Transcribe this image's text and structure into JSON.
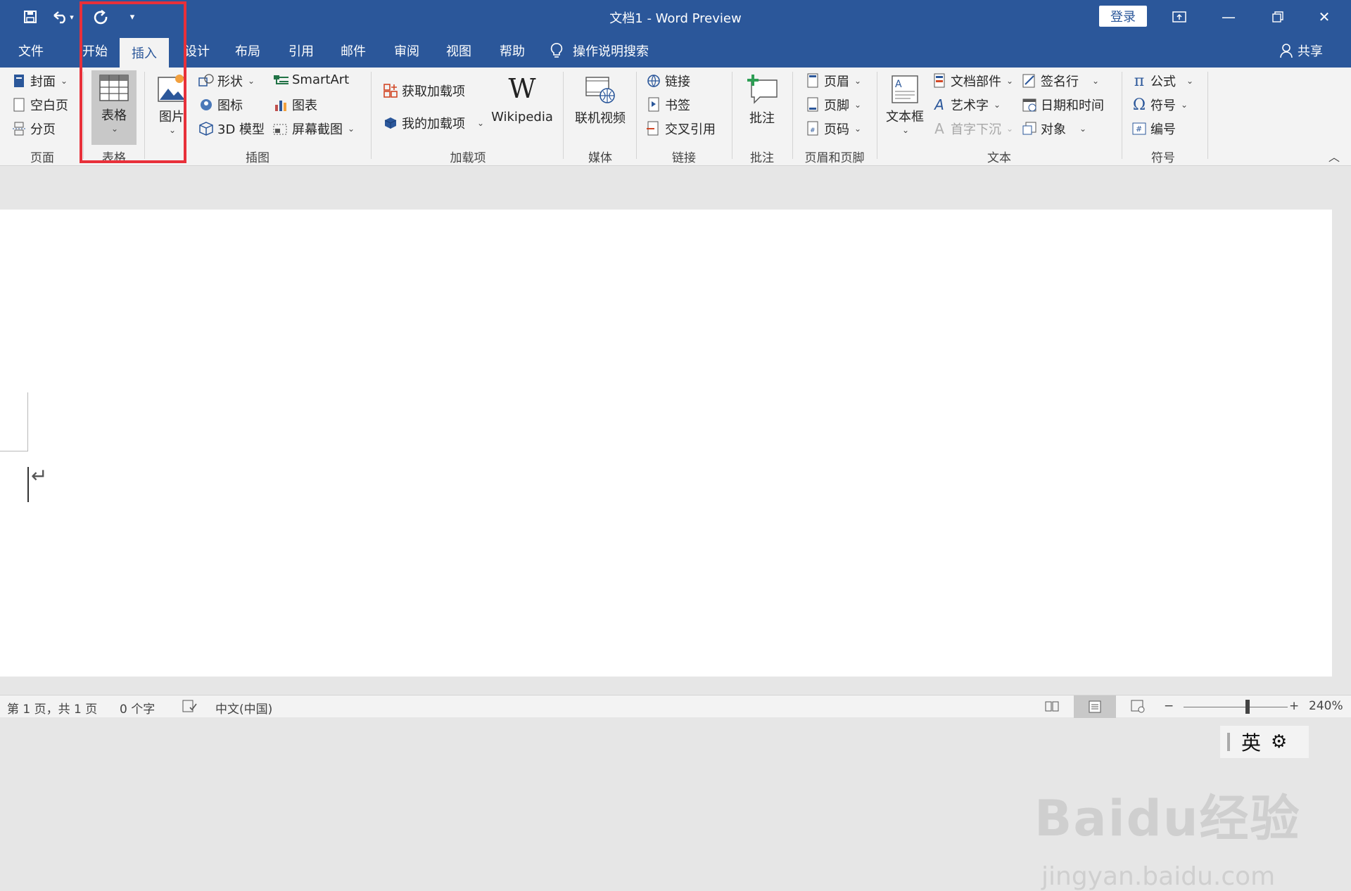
{
  "titlebar": {
    "doc_title": "文档1  -  Word Preview",
    "login": "登录"
  },
  "qat": {
    "save_icon": "save-icon",
    "undo_icon": "undo-icon",
    "redo_icon": "redo-icon",
    "customize_icon": "customize-icon"
  },
  "tabs": [
    "文件",
    "开始",
    "插入",
    "设计",
    "布局",
    "引用",
    "邮件",
    "审阅",
    "视图",
    "帮助"
  ],
  "tab_visible": [
    "文件",
    "开始",
    "插入",
    "设计",
    "布局",
    "引用",
    "邮件",
    "审阅",
    "视图",
    "帮助"
  ],
  "active_tab": "插入",
  "tell_me": "操作说明搜索",
  "share": "共享",
  "ribbon": {
    "pages": {
      "cover": "封面",
      "blank": "空白页",
      "break": "分页",
      "group": "页面"
    },
    "table": {
      "label": "表格",
      "group": "表格"
    },
    "illustrations": {
      "picture": "图片",
      "shapes": "形状",
      "icons": "图标",
      "model3d": "3D 模型",
      "smartart": "SmartArt",
      "chart": "图表",
      "screenshot": "屏幕截图",
      "group": "插图"
    },
    "addins": {
      "get": "获取加载项",
      "mine": "我的加载项",
      "wikipedia": "Wikipedia",
      "group": "加载项"
    },
    "media": {
      "video": "联机视频",
      "group": "媒体"
    },
    "links": {
      "link": "链接",
      "bookmark": "书签",
      "crossref": "交叉引用",
      "group": "链接"
    },
    "comments": {
      "comment": "批注",
      "group": "批注"
    },
    "header_footer": {
      "header": "页眉",
      "footer": "页脚",
      "pagenum": "页码",
      "group": "页眉和页脚"
    },
    "text": {
      "textbox": "文本框",
      "quickparts": "文档部件",
      "wordart": "艺术字",
      "dropcap": "首字下沉",
      "sigline": "签名行",
      "datetime": "日期和时间",
      "object": "对象",
      "group": "文本"
    },
    "symbols": {
      "equation": "公式",
      "symbol": "符号",
      "number": "编号",
      "group": "符号"
    }
  },
  "status": {
    "page": "第 1 页，共 1 页",
    "words": "0 个字",
    "lang": "中文(中国)",
    "zoom": "240%"
  },
  "ime": {
    "mode": "英"
  },
  "watermark": {
    "logo": "Baidu经验",
    "url": "jingyan.baidu.com"
  }
}
